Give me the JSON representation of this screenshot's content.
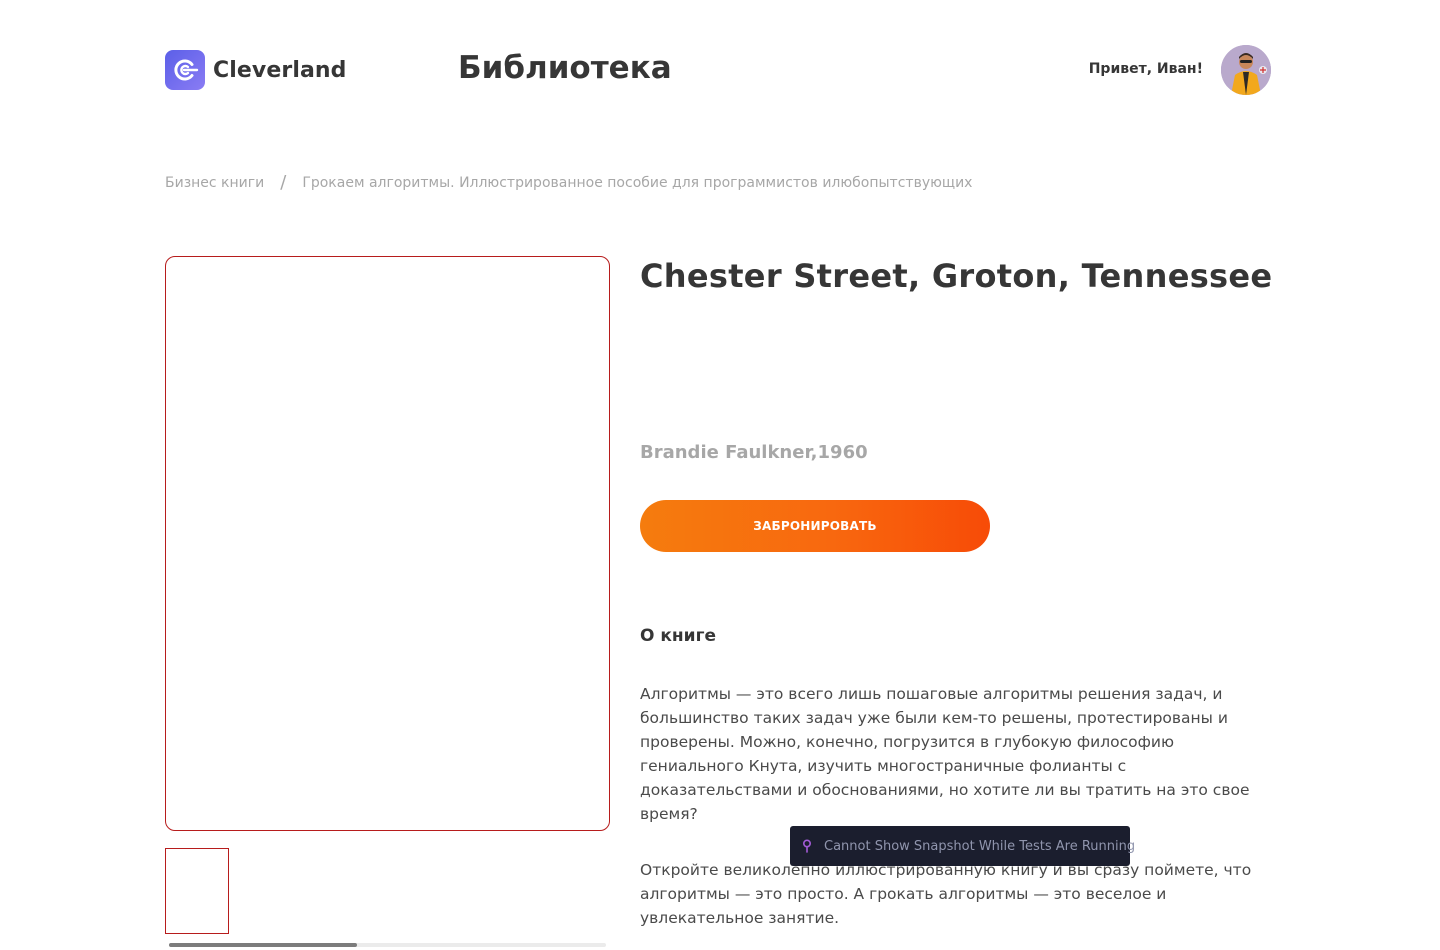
{
  "header": {
    "logo_text": "Cleverland",
    "page_title": "Библиотека",
    "greeting": "Привет, Иван!"
  },
  "breadcrumb": {
    "category": "Бизнес книги",
    "separator": "/",
    "current": "Грокаем алгоритмы. Иллюстрированное пособие для программистов илюбопытствующих"
  },
  "book": {
    "title": "Chester Street, Groton, Tennessee",
    "author_year": "Brandie Faulkner,1960",
    "reserve_label": "ЗАБРОНИРОВАТЬ",
    "about_heading": "О книге",
    "about_paragraph_1": "Алгоритмы — это всего лишь пошаговые алгоритмы решения задач, и большинство таких задач уже были кем-то решены, протестированы и проверены. Можно, конечно, погрузится в глубокую философию гениального Кнута, изучить многостраничные фолианты с доказательствами и обоснованиями, но хотите ли вы тратить на это свое время?",
    "about_paragraph_2": "Откройте великолепно иллюстрированную книгу и вы сразу поймете, что алгоритмы — это просто. А грокать алгоритмы — это веселое и увлекательное занятие."
  },
  "gallery": {
    "scroll_position": 0.43
  },
  "toast": {
    "text": "Cannot Show Snapshot While Tests Are Running",
    "icon": "pin-icon"
  },
  "colors": {
    "accent_start": "#f57c0e",
    "accent_end": "#f74b07",
    "logo": "#5b5fe8",
    "cover_border": "#b71c1c",
    "muted_text": "#a7a7a7"
  }
}
